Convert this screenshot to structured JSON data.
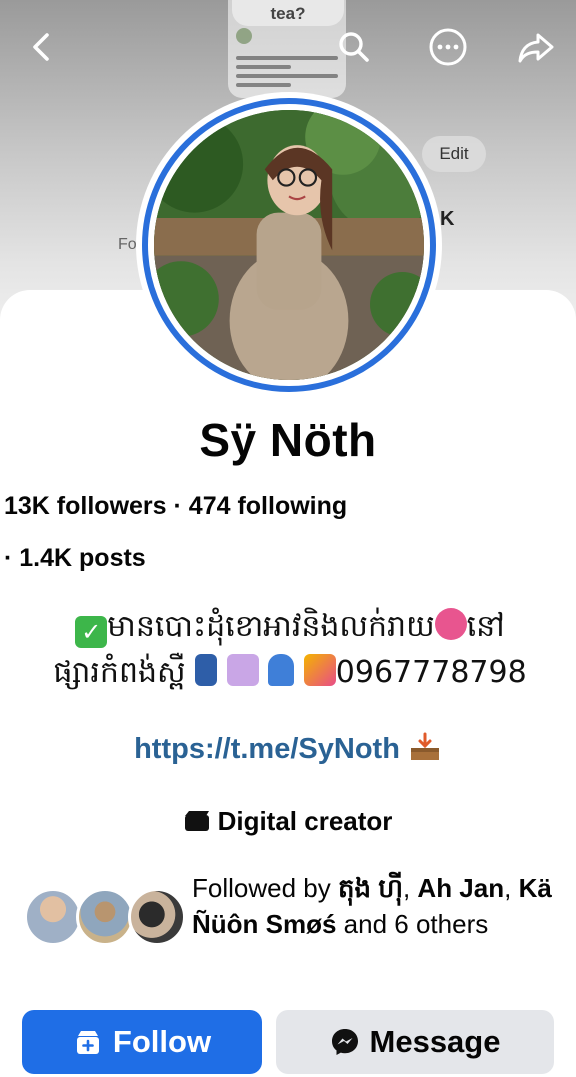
{
  "cover": {
    "ghost_question": "tea?",
    "ghost_edit": "Edit",
    "ghost_k": "K",
    "ghost_fo": "Fo"
  },
  "header": {
    "back_icon": "chevron-left-icon",
    "search_icon": "search-icon",
    "more_icon": "more-horizontal-icon",
    "share_icon": "share-icon"
  },
  "profile": {
    "name": "Sÿ Nöth",
    "followers": "13K followers",
    "following": "474 following",
    "posts": "1.4K posts",
    "bio_line1": "មានបោះដុំខោអាវនិងលក់រាយ",
    "bio_line1_end": "នៅ",
    "bio_line2_start": "ផ្សារកំពង់ស្ពឺ",
    "bio_phone": "0967778798",
    "link": "https://t.me/SyNoth",
    "category": "Digital creator"
  },
  "mutual": {
    "prefix": "Followed by ",
    "name1": "តុង ហ៊ី",
    "sep1": ", ",
    "name2": "Ah Jan",
    "sep2": ", ",
    "name3": "Kä Ñüôn Smøś",
    "suffix": " and 6 others"
  },
  "actions": {
    "follow_label": "Follow",
    "message_label": "Message"
  },
  "colors": {
    "accent": "#1f6ee6",
    "link": "#2a6294",
    "ring": "#2a6fdb"
  }
}
